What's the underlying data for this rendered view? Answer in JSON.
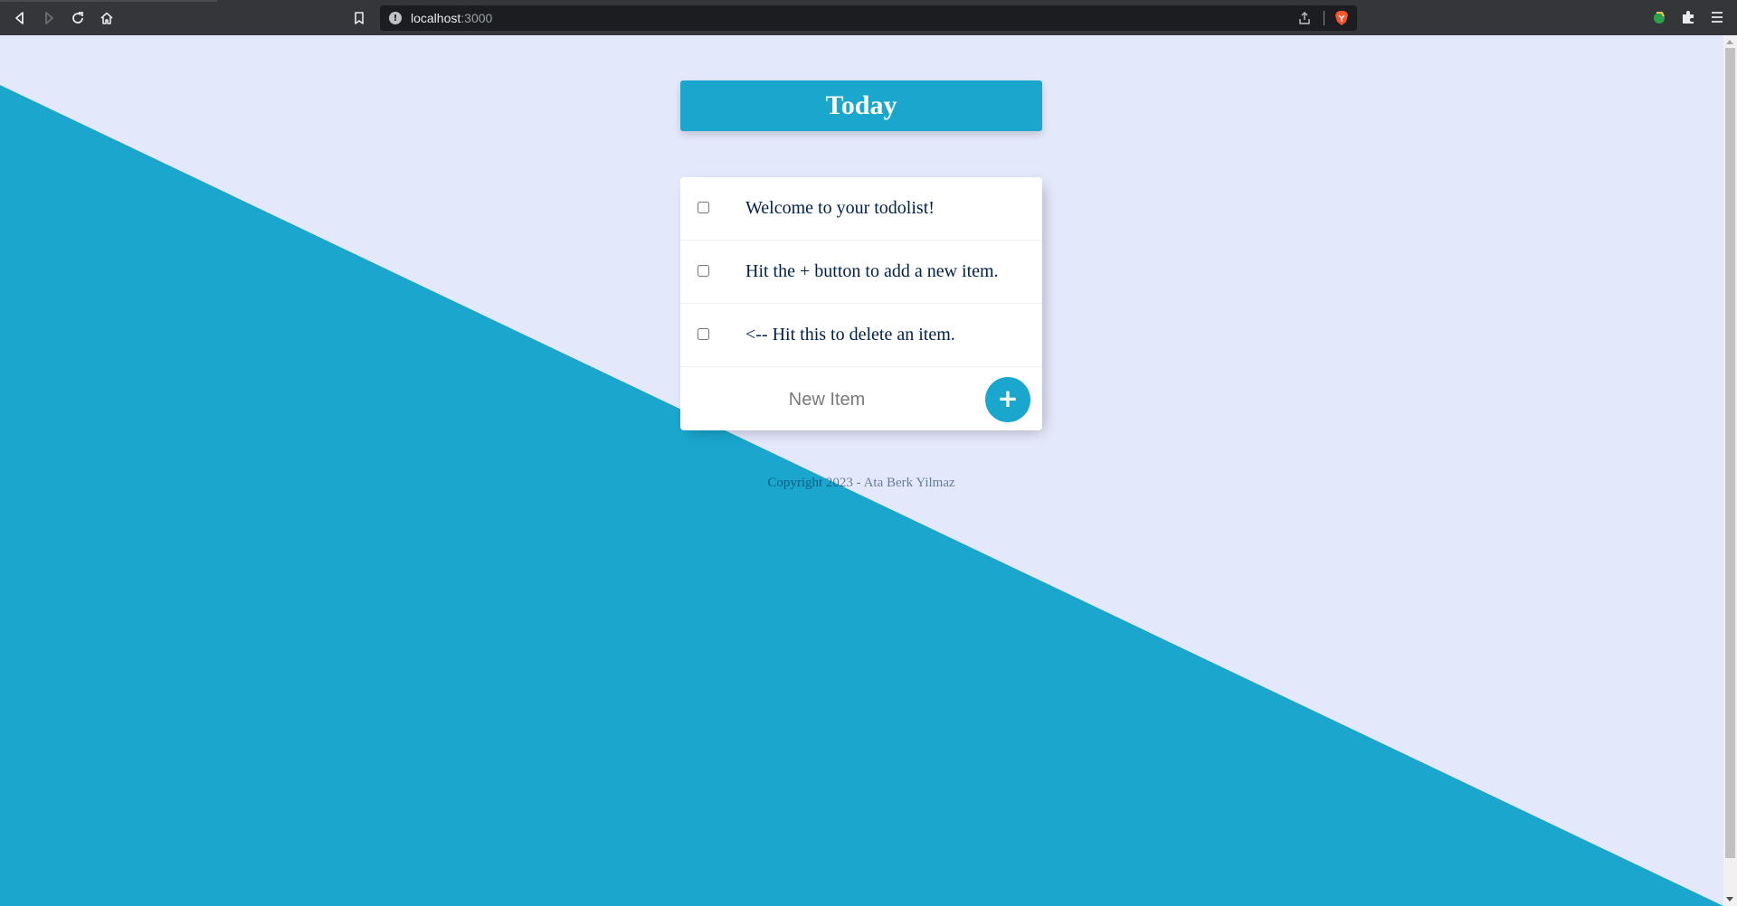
{
  "browser": {
    "url_host": "localhost",
    "url_port": ":3000"
  },
  "page": {
    "heading": "Today",
    "items": [
      {
        "text": "Welcome to your todolist!"
      },
      {
        "text": "Hit the + button to add a new item."
      },
      {
        "text": "<-- Hit this to delete an item."
      }
    ],
    "new_item_placeholder": "New Item",
    "add_button_label": "+",
    "footer": "Copyright 2023 - Ata Berk Yilmaz"
  },
  "colors": {
    "accent": "#1aa6cd",
    "background": "#e3e8fb",
    "text": "#00204a",
    "chrome_bar": "#35363a"
  },
  "icons": {
    "back": "back-icon",
    "forward": "forward-icon",
    "reload": "reload-icon",
    "home": "home-icon",
    "bookmark": "bookmark-icon",
    "site_info": "site-info-icon",
    "share": "share-icon",
    "brave_shields": "brave-shields-icon",
    "wallet": "wallet-icon",
    "extensions": "extensions-icon",
    "menu": "menu-icon"
  }
}
